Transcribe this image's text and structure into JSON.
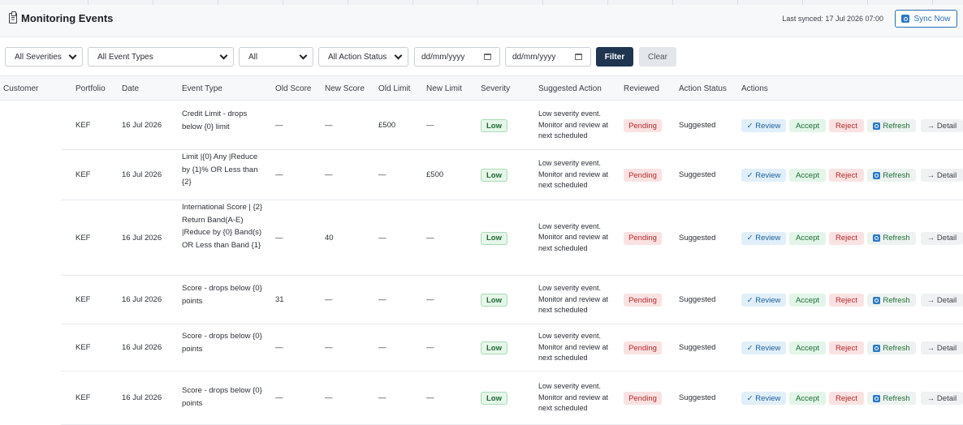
{
  "header": {
    "title": "Monitoring Events",
    "title_icon": "clipboard-icon",
    "last_synced": "Last synced: 17 Jul 2026 07:00",
    "sync_label": "Sync Now"
  },
  "filters": {
    "severity": "All Severities",
    "event_types": "All Event Types",
    "reviewed": "All",
    "action_status": "All Action Status",
    "date_from_placeholder": "dd/mm/yyyy",
    "date_to_placeholder": "dd/mm/yyyy",
    "filter_label": "Filter",
    "clear_label": "Clear"
  },
  "columns": [
    "Customer",
    "Portfolio",
    "Date",
    "Event Type",
    "Old Score",
    "New Score",
    "Old Limit",
    "New Limit",
    "Severity",
    "Suggested Action",
    "Reviewed",
    "Action Status",
    "Actions"
  ],
  "actions": {
    "review": "✓ Review",
    "accept": "Accept",
    "reject": "Reject",
    "refresh": "Refresh",
    "detail": "→ Detail"
  },
  "rows": [
    {
      "customer": "",
      "portfolio": "KEF",
      "date": "16 Jul 2026",
      "event_type": "Credit Limit - drops below {0} limit",
      "old_score": "—",
      "new_score": "—",
      "old_limit": "£500",
      "new_limit": "—",
      "severity": "Low",
      "suggested_action": "Low severity event. Monitor and review at next scheduled",
      "reviewed": "Pending",
      "action_status": "Suggested"
    },
    {
      "customer": "",
      "portfolio": "KEF",
      "date": "16 Jul 2026",
      "event_type": "Limit |{0} Any |Reduce by {1}% OR Less than {2}",
      "old_score": "—",
      "new_score": "—",
      "old_limit": "—",
      "new_limit": "£500",
      "severity": "Low",
      "suggested_action": "Low severity event. Monitor and review at next scheduled",
      "reviewed": "Pending",
      "action_status": "Suggested"
    },
    {
      "customer": "",
      "portfolio": "KEF",
      "date": "16 Jul 2026",
      "event_type": "International Score | {2} Return Band(A-E) |Reduce by {0} Band(s) OR Less than Band {1}",
      "old_score": "—",
      "new_score": "40",
      "old_limit": "—",
      "new_limit": "—",
      "severity": "Low",
      "suggested_action": "Low severity event. Monitor and review at next scheduled",
      "reviewed": "Pending",
      "action_status": "Suggested"
    },
    {
      "customer": "",
      "portfolio": "KEF",
      "date": "16 Jul 2026",
      "event_type": "Score - drops below {0} points",
      "old_score": "31",
      "new_score": "—",
      "old_limit": "—",
      "new_limit": "—",
      "severity": "Low",
      "suggested_action": "Low severity event. Monitor and review at next scheduled",
      "reviewed": "Pending",
      "action_status": "Suggested"
    },
    {
      "customer": "",
      "portfolio": "KEF",
      "date": "16 Jul 2026",
      "event_type": "Score - drops below {0} points",
      "old_score": "—",
      "new_score": "—",
      "old_limit": "—",
      "new_limit": "—",
      "severity": "Low",
      "suggested_action": "Low severity event. Monitor and review at next scheduled",
      "reviewed": "Pending",
      "action_status": "Suggested"
    },
    {
      "customer": "",
      "portfolio": "KEF",
      "date": "16 Jul 2026",
      "event_type": "Score - drops below {0} points",
      "old_score": "—",
      "new_score": "—",
      "old_limit": "—",
      "new_limit": "—",
      "severity": "Low",
      "suggested_action": "Low severity event. Monitor and review at next scheduled",
      "reviewed": "Pending",
      "action_status": "Suggested"
    }
  ]
}
